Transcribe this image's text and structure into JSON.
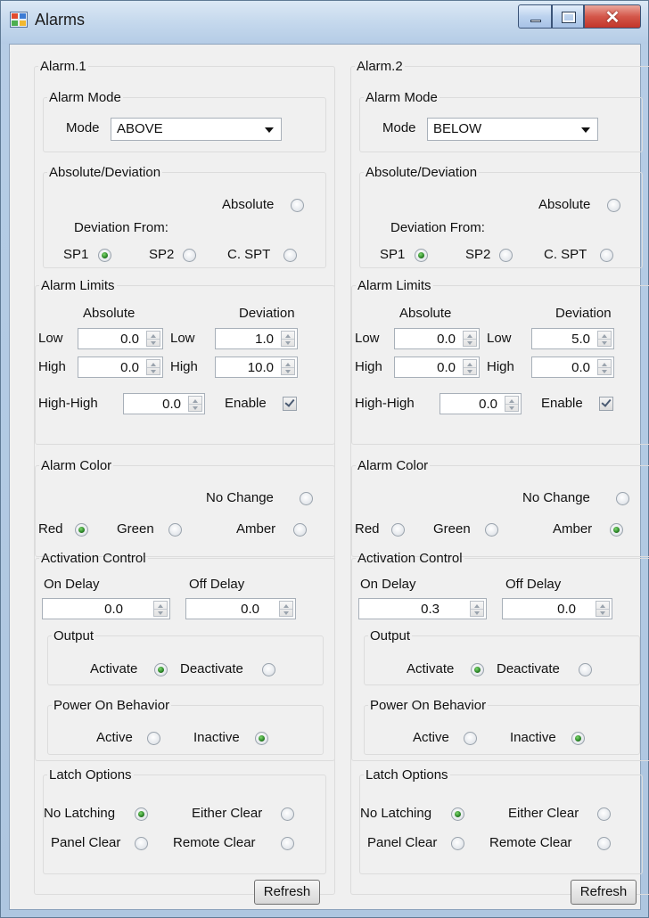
{
  "window": {
    "title": "Alarms"
  },
  "alarms": [
    {
      "name": "Alarm.1",
      "mode_group": "Alarm Mode",
      "mode_label": "Mode",
      "mode_value": "ABOVE",
      "absdev_group": "Absolute/Deviation",
      "absolute_label": "Absolute",
      "deviation_from_label": "Deviation From:",
      "sp1_label": "SP1",
      "sp2_label": "SP2",
      "cspt_label": "C. SPT",
      "selected_source": "SP1",
      "limits_group": "Alarm Limits",
      "absolute_col": "Absolute",
      "deviation_col": "Deviation",
      "low_label": "Low",
      "high_label": "High",
      "abs_low": "0.0",
      "abs_high": "0.0",
      "dev_low": "1.0",
      "dev_high": "10.0",
      "highhigh_label": "High-High",
      "highhigh_value": "0.0",
      "enable_label": "Enable",
      "enable_checked": true,
      "color_group": "Alarm Color",
      "no_change_label": "No Change",
      "red_label": "Red",
      "green_label": "Green",
      "amber_label": "Amber",
      "selected_color": "Red",
      "activation_group": "Activation Control",
      "on_delay_label": "On Delay",
      "off_delay_label": "Off Delay",
      "on_delay_value": "0.0",
      "off_delay_value": "0.0",
      "output_group": "Output",
      "activate_label": "Activate",
      "deactivate_label": "Deactivate",
      "selected_output": "Activate",
      "power_group": "Power On Behavior",
      "active_label": "Active",
      "inactive_label": "Inactive",
      "selected_power": "Inactive",
      "latch_group": "Latch Options",
      "no_latching_label": "No Latching",
      "either_clear_label": "Either Clear",
      "panel_clear_label": "Panel Clear",
      "remote_clear_label": "Remote Clear",
      "selected_latch": "No Latching",
      "refresh_label": "Refresh"
    },
    {
      "name": "Alarm.2",
      "mode_group": "Alarm Mode",
      "mode_label": "Mode",
      "mode_value": "BELOW",
      "absdev_group": "Absolute/Deviation",
      "absolute_label": "Absolute",
      "deviation_from_label": "Deviation From:",
      "sp1_label": "SP1",
      "sp2_label": "SP2",
      "cspt_label": "C. SPT",
      "selected_source": "SP1",
      "limits_group": "Alarm Limits",
      "absolute_col": "Absolute",
      "deviation_col": "Deviation",
      "low_label": "Low",
      "high_label": "High",
      "abs_low": "0.0",
      "abs_high": "0.0",
      "dev_low": "5.0",
      "dev_high": "0.0",
      "highhigh_label": "High-High",
      "highhigh_value": "0.0",
      "enable_label": "Enable",
      "enable_checked": true,
      "color_group": "Alarm Color",
      "no_change_label": "No Change",
      "red_label": "Red",
      "green_label": "Green",
      "amber_label": "Amber",
      "selected_color": "Amber",
      "activation_group": "Activation Control",
      "on_delay_label": "On Delay",
      "off_delay_label": "Off Delay",
      "on_delay_value": "0.3",
      "off_delay_value": "0.0",
      "output_group": "Output",
      "activate_label": "Activate",
      "deactivate_label": "Deactivate",
      "selected_output": "Activate",
      "power_group": "Power On Behavior",
      "active_label": "Active",
      "inactive_label": "Inactive",
      "selected_power": "Inactive",
      "latch_group": "Latch Options",
      "no_latching_label": "No Latching",
      "either_clear_label": "Either Clear",
      "panel_clear_label": "Panel Clear",
      "remote_clear_label": "Remote Clear",
      "selected_latch": "No Latching",
      "refresh_label": "Refresh"
    }
  ]
}
